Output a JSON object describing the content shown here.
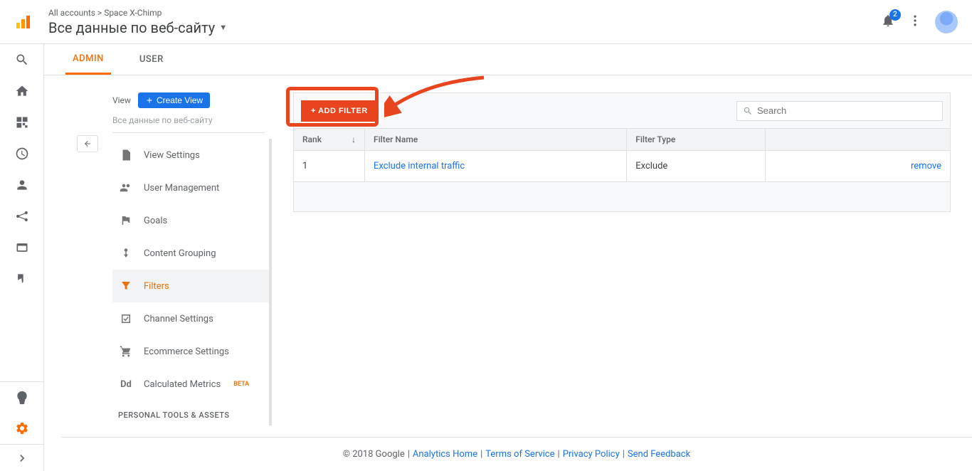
{
  "header": {
    "breadcrumb_prefix": "All accounts",
    "breadcrumb_account": "Space X-Chimp",
    "view_title": "Все данные по веб-сайту",
    "notification_count": "2"
  },
  "tabs": {
    "admin": "ADMIN",
    "user": "USER"
  },
  "sidebar_col": {
    "label": "View",
    "create_btn": "Create View",
    "view_name": "Все данные по веб-сайту"
  },
  "sidebar_items": {
    "view_settings": "View Settings",
    "user_management": "User Management",
    "goals": "Goals",
    "content_grouping": "Content Grouping",
    "filters": "Filters",
    "channel_settings": "Channel Settings",
    "ecommerce_settings": "Ecommerce Settings",
    "calculated_metrics": "Calculated Metrics",
    "calculated_metrics_beta": "BETA",
    "section_personal": "PERSONAL TOOLS & ASSETS"
  },
  "panel": {
    "add_filter": "+ ADD FILTER",
    "search_placeholder": "Search",
    "col_rank": "Rank",
    "col_filter_name": "Filter Name",
    "col_filter_type": "Filter Type"
  },
  "rows": [
    {
      "rank": "1",
      "name": "Exclude internal traffic",
      "type": "Exclude",
      "action": "remove"
    }
  ],
  "footer": {
    "copyright": "© 2018 Google",
    "home": "Analytics Home",
    "terms": "Terms of Service",
    "privacy": "Privacy Policy",
    "feedback": "Send Feedback"
  }
}
